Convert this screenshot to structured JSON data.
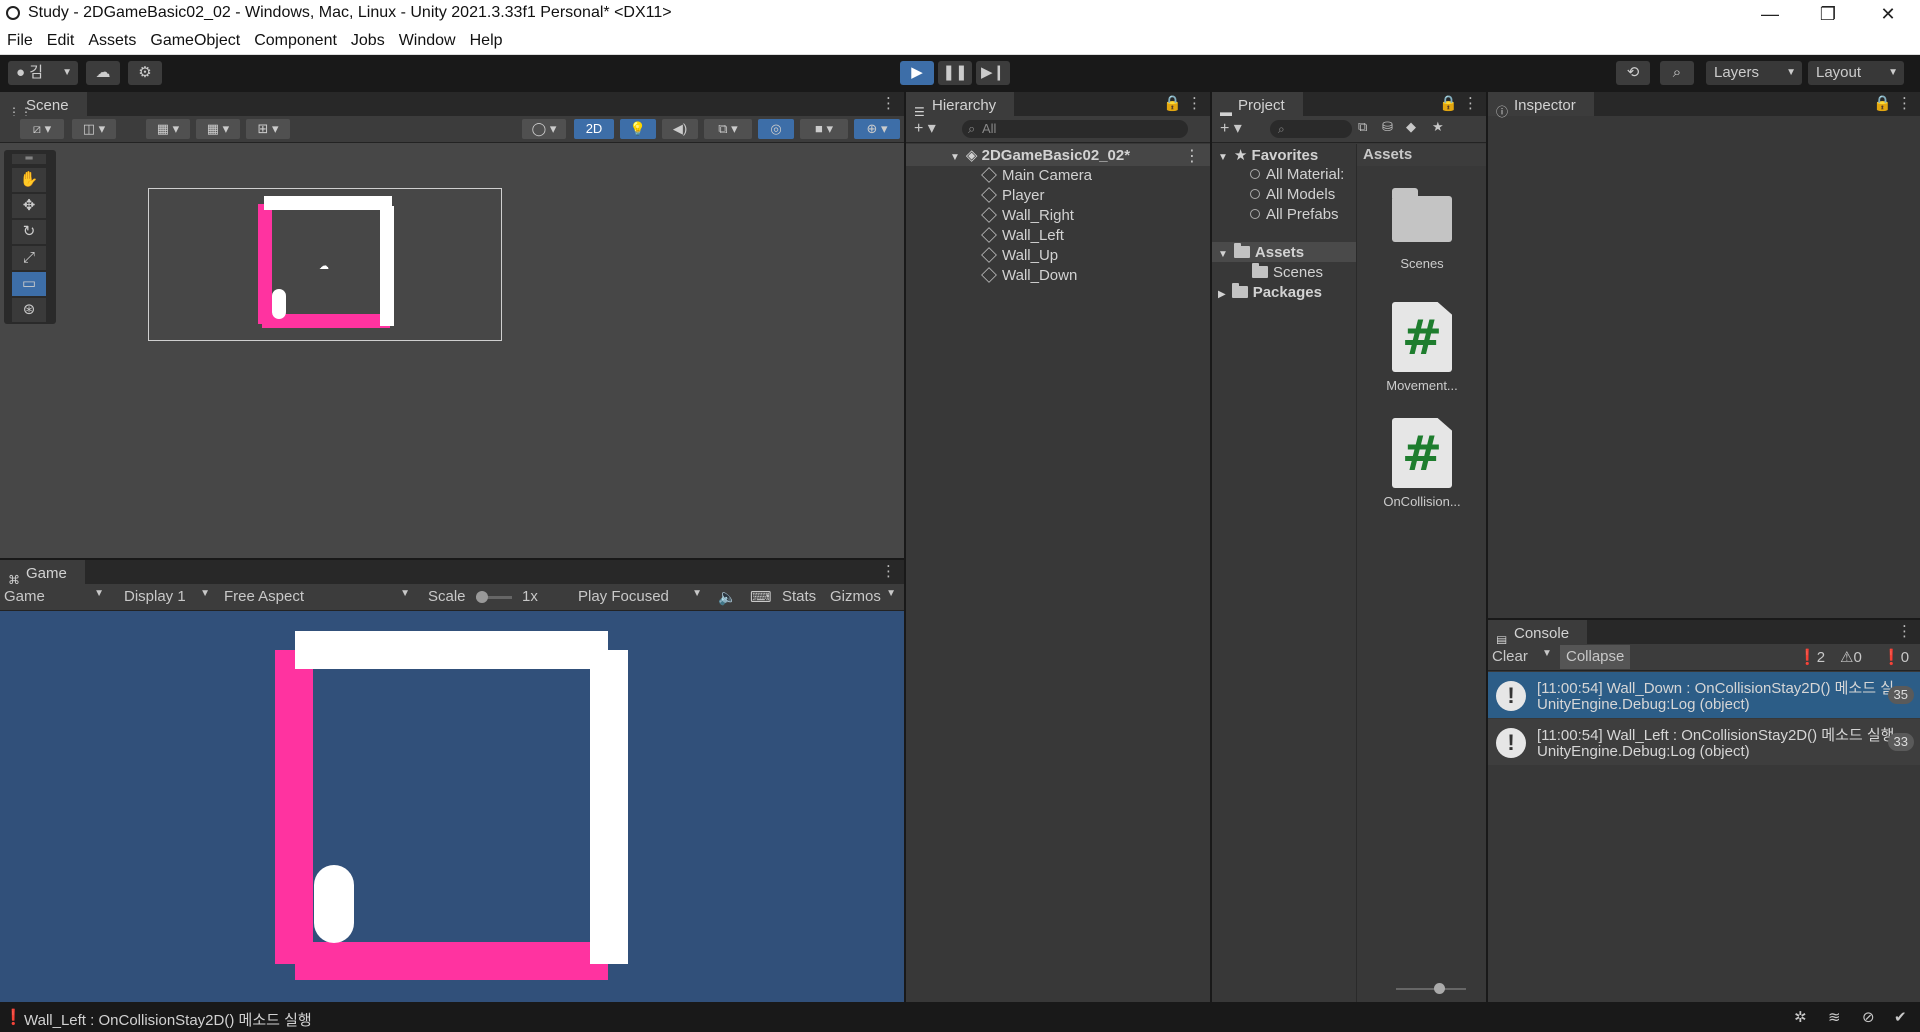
{
  "window": {
    "title": "Study - 2DGameBasic02_02 - Windows, Mac, Linux - Unity 2021.3.33f1 Personal* <DX11>",
    "minimize": "—",
    "maximize": "❐",
    "close": "✕"
  },
  "menu": [
    "File",
    "Edit",
    "Assets",
    "GameObject",
    "Component",
    "Jobs",
    "Window",
    "Help"
  ],
  "toolbar": {
    "account_label": "김",
    "play_icon": "play-icon",
    "pause_icon": "pause-icon",
    "step_icon": "step-icon",
    "layers_label": "Layers",
    "layout_label": "Layout"
  },
  "scene": {
    "tab_label": "Scene",
    "mode_2d": "2D"
  },
  "game": {
    "tab_label": "Game",
    "view_select": "Game",
    "display_select": "Display 1",
    "aspect_select": "Free Aspect",
    "scale_label": "Scale",
    "scale_value": "1x",
    "play_mode": "Play Focused",
    "stats_label": "Stats",
    "gizmos_label": "Gizmos",
    "colors": {
      "background": "#31507a",
      "wall_pink": "#ff33a0",
      "wall_white": "#ffffff"
    }
  },
  "hierarchy": {
    "tab_label": "Hierarchy",
    "search_placeholder": "All",
    "scene_name": "2DGameBasic02_02*",
    "objects": [
      "Main Camera",
      "Player",
      "Wall_Right",
      "Wall_Left",
      "Wall_Up",
      "Wall_Down"
    ]
  },
  "project": {
    "tab_label": "Project",
    "favorites_label": "Favorites",
    "favorites": [
      "All Material:",
      "All Models",
      "All Prefabs"
    ],
    "assets_label": "Assets",
    "asset_folders": [
      "Scenes"
    ],
    "packages_label": "Packages",
    "breadcrumb": "Assets",
    "grid_items": [
      {
        "label": "Scenes",
        "kind": "folder"
      },
      {
        "label": "Movement...",
        "kind": "script"
      },
      {
        "label": "OnCollision...",
        "kind": "script"
      }
    ],
    "script_glyph": "#"
  },
  "inspector": {
    "tab_label": "Inspector"
  },
  "console": {
    "tab_label": "Console",
    "clear_label": "Clear",
    "collapse_label": "Collapse",
    "info_count": "2",
    "warn_count": "0",
    "error_count": "0",
    "entries": [
      {
        "line1": "[11:00:54] Wall_Down : OnCollisionStay2D() 메소드 실",
        "line2": "UnityEngine.Debug:Log (object)",
        "count": "35"
      },
      {
        "line1": "[11:00:54] Wall_Left : OnCollisionStay2D() 메소드 실행",
        "line2": "UnityEngine.Debug:Log (object)",
        "count": "33"
      }
    ]
  },
  "status_bar": {
    "message": "Wall_Left : OnCollisionStay2D() 메소드 실행"
  }
}
